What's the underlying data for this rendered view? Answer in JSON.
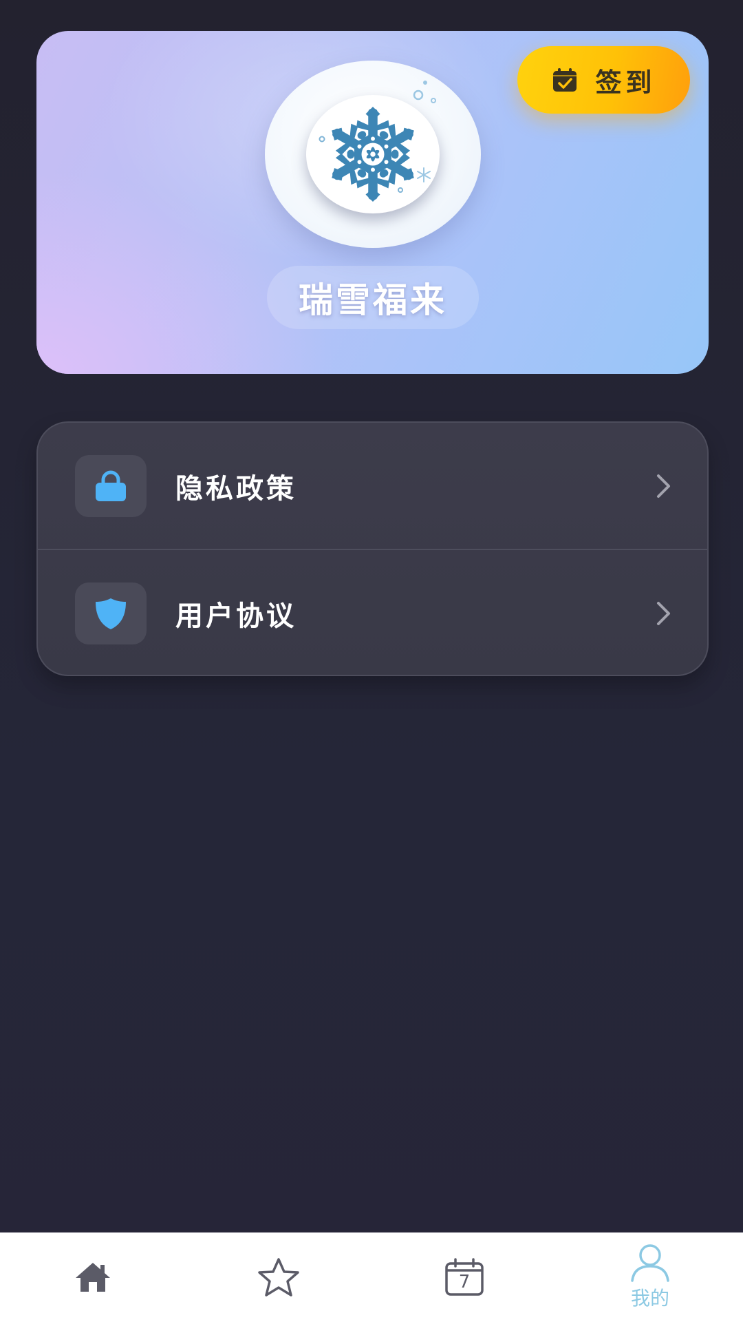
{
  "header": {
    "checkin_label": "签到",
    "username": "瑞雪福来"
  },
  "menu": {
    "items": [
      {
        "label": "隐私政策",
        "icon": "lock-icon"
      },
      {
        "label": "用户协议",
        "icon": "shield-icon"
      }
    ]
  },
  "bottom_nav": {
    "items": [
      {
        "id": "home",
        "icon": "home-icon",
        "label": ""
      },
      {
        "id": "favorites",
        "icon": "star-icon",
        "label": ""
      },
      {
        "id": "calendar",
        "icon": "calendar-icon",
        "label": "",
        "date": "7"
      },
      {
        "id": "mine",
        "icon": "user-icon",
        "label": "我的",
        "active": true
      }
    ]
  },
  "colors": {
    "accent_blue": "#4fb3f6",
    "checkin_yellow": "#ffc107",
    "nav_active": "#8cc9e3",
    "nav_inactive": "#5b5b67",
    "background": "#24243a"
  }
}
